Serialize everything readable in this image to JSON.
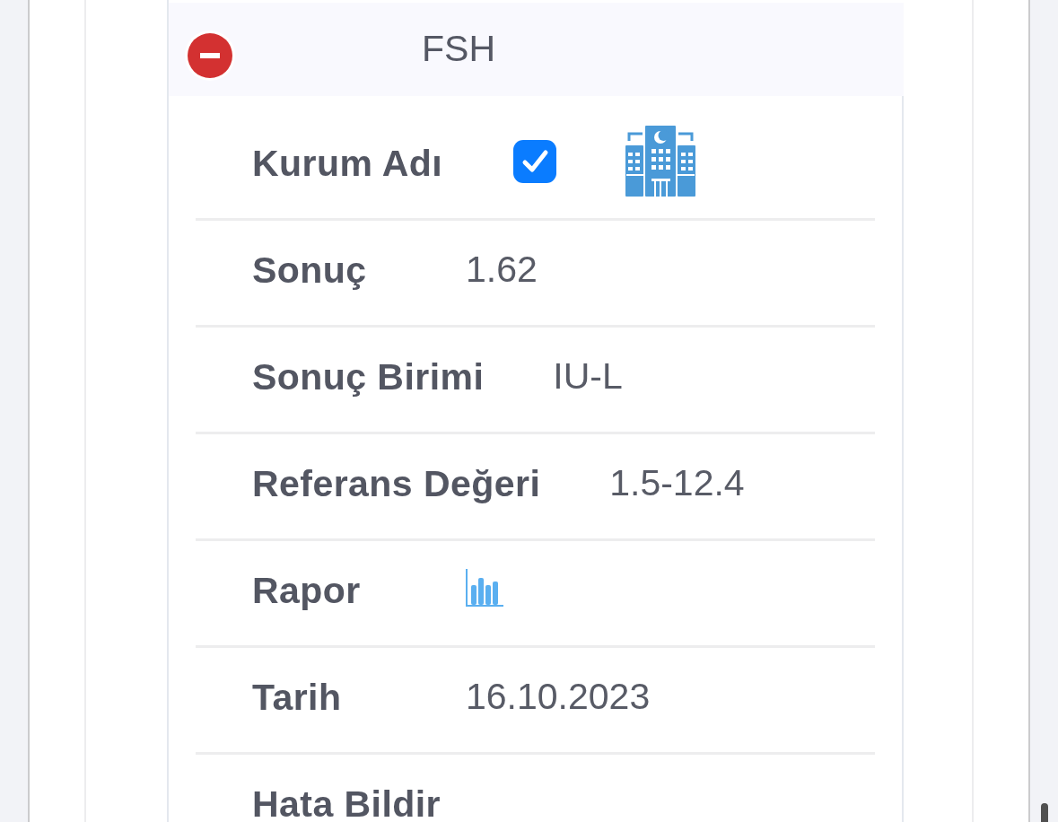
{
  "header": {
    "title": "FSH"
  },
  "fields": [
    {
      "kind": "institution",
      "label": "Kurum Adı",
      "checked": true
    },
    {
      "kind": "text",
      "label": "Sonuç",
      "value": "1.62"
    },
    {
      "kind": "text",
      "label": "Sonuç Birimi",
      "value": "IU-L"
    },
    {
      "kind": "text",
      "label": "Referans Değeri",
      "value": "1.5-12.4"
    },
    {
      "kind": "report",
      "label": "Rapor"
    },
    {
      "kind": "text",
      "label": "Tarih",
      "value": "16.10.2023"
    },
    {
      "kind": "action",
      "label": "Hata Bildir"
    }
  ]
}
